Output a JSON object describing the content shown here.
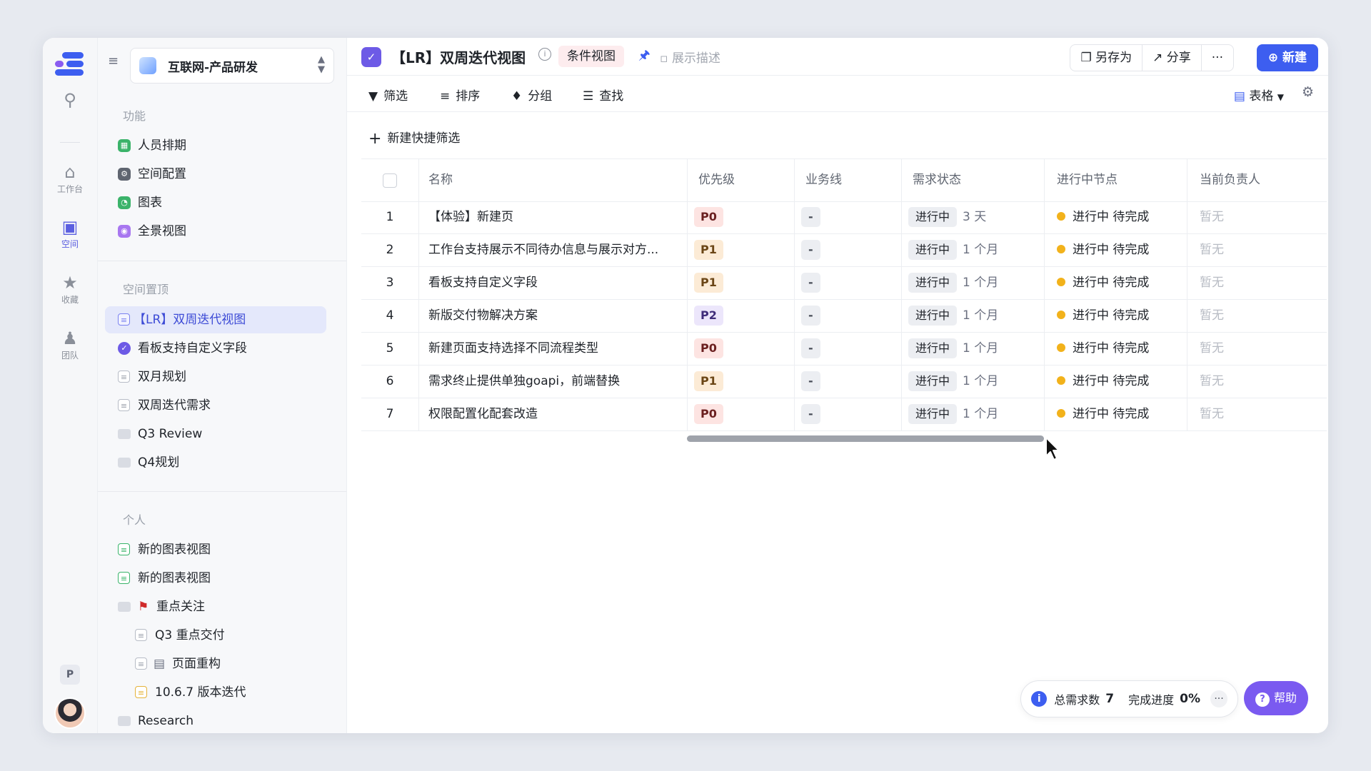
{
  "rail": {
    "workbench": "工作台",
    "space": "空间",
    "favorites": "收藏",
    "team": "团队",
    "user_badge": "P"
  },
  "sidebar": {
    "space_name": "互联网-产品研发",
    "features_title": "功能",
    "features": [
      {
        "label": "人员排期",
        "icon": "schedule-icon",
        "color": "#3bb36a"
      },
      {
        "label": "空间配置",
        "icon": "config-icon",
        "color": "#6b7080"
      },
      {
        "label": "图表",
        "icon": "chart-icon",
        "color": "#3bb36a"
      },
      {
        "label": "全景视图",
        "icon": "panorama-icon",
        "color": "#a877f0"
      }
    ],
    "pinned_title": "空间置顶",
    "pinned": [
      {
        "label": "【LR】双周迭代视图",
        "active": true
      },
      {
        "label": "看板支持自定义字段"
      },
      {
        "label": "双月规划"
      },
      {
        "label": "双周迭代需求"
      },
      {
        "label": "Q3 Review"
      },
      {
        "label": "Q4规划"
      }
    ],
    "personal_title": "个人",
    "personal": [
      {
        "label": "新的图表视图"
      },
      {
        "label": "新的图表视图"
      },
      {
        "label": "重点关注"
      },
      {
        "label": "Q3 重点交付"
      },
      {
        "label": "页面重构"
      },
      {
        "label": "10.6.7 版本迭代"
      },
      {
        "label": "Research"
      }
    ]
  },
  "header": {
    "title": "【LR】双周迭代视图",
    "view_tag": "条件视图",
    "show_desc": "展示描述",
    "save_as": "另存为",
    "share": "分享",
    "more": "···",
    "new_button": "新建"
  },
  "toolbar": {
    "filter": "筛选",
    "sort": "排序",
    "group": "分组",
    "find": "查找",
    "view_mode": "表格",
    "quick_filter": "新建快捷筛选"
  },
  "table": {
    "columns": [
      "名称",
      "优先级",
      "业务线",
      "需求状态",
      "进行中节点",
      "当前负责人"
    ],
    "rows": [
      {
        "no": "1",
        "name": "【体验】新建页",
        "priority": "P0",
        "biz": "-",
        "state": "进行中",
        "duration": "3 天",
        "node": "进行中 待完成",
        "owner": "暂无"
      },
      {
        "no": "2",
        "name": "工作台支持展示不同待办信息与展示对方...",
        "priority": "P1",
        "biz": "-",
        "state": "进行中",
        "duration": "1 个月",
        "node": "进行中 待完成",
        "owner": "暂无"
      },
      {
        "no": "3",
        "name": "看板支持自定义字段",
        "priority": "P1",
        "biz": "-",
        "state": "进行中",
        "duration": "1 个月",
        "node": "进行中 待完成",
        "owner": "暂无"
      },
      {
        "no": "4",
        "name": "新版交付物解决方案",
        "priority": "P2",
        "biz": "-",
        "state": "进行中",
        "duration": "1 个月",
        "node": "进行中 待完成",
        "owner": "暂无"
      },
      {
        "no": "5",
        "name": "新建页面支持选择不同流程类型",
        "priority": "P0",
        "biz": "-",
        "state": "进行中",
        "duration": "1 个月",
        "node": "进行中 待完成",
        "owner": "暂无"
      },
      {
        "no": "6",
        "name": "需求终止提供单独goapi，前端替换",
        "priority": "P1",
        "biz": "-",
        "state": "进行中",
        "duration": "1 个月",
        "node": "进行中 待完成",
        "owner": "暂无"
      },
      {
        "no": "7",
        "name": "权限配置化配套改造",
        "priority": "P0",
        "biz": "-",
        "state": "进行中",
        "duration": "1 个月",
        "node": "进行中 待完成",
        "owner": "暂无"
      }
    ]
  },
  "footer": {
    "total_label": "总需求数",
    "total_value": "7",
    "progress_label": "完成进度",
    "progress_value": "0%",
    "more": "···",
    "help": "帮助"
  },
  "colors": {
    "accent": "#3d5ef0",
    "help": "#7a5af0",
    "status_dot": "#f2b21b"
  }
}
